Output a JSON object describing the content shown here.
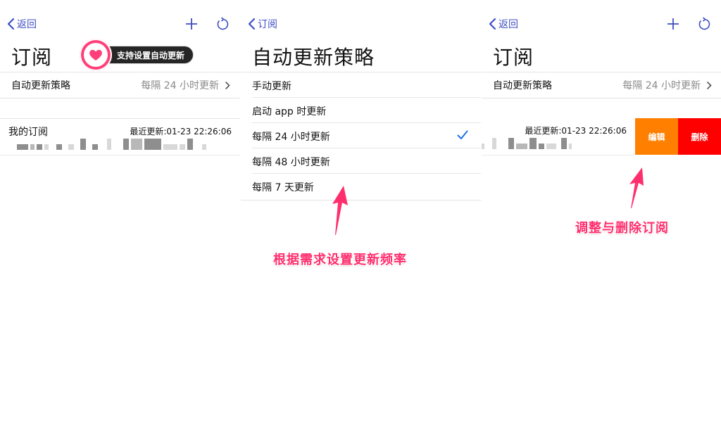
{
  "colors": {
    "accent": "#3d4fc4",
    "check": "#1a73e8",
    "edit": "#ff8000",
    "delete": "#ff0000",
    "annotation": "#ff2e6d",
    "callout_bg": "#262626"
  },
  "panel1": {
    "back_label": "返回",
    "plus_icon": "plus-icon",
    "refresh_icon": "refresh-icon",
    "title": "订阅",
    "callout": "支持设置自动更新",
    "policy_row": {
      "label": "自动更新策略",
      "value": "每隔 24 小时更新"
    },
    "subscription": {
      "name": "我的订阅",
      "last_update": "最近更新:01-23 22:26:06"
    }
  },
  "panel2": {
    "back_label": "订阅",
    "title": "自动更新策略",
    "options": [
      {
        "label": "手动更新",
        "selected": false
      },
      {
        "label": "启动 app 时更新",
        "selected": false
      },
      {
        "label": "每隔 24 小时更新",
        "selected": true
      },
      {
        "label": "每隔 48 小时更新",
        "selected": false
      },
      {
        "label": "每隔 7 天更新",
        "selected": false
      }
    ],
    "annotation": "根据需求设置更新频率"
  },
  "panel3": {
    "back_label": "返回",
    "title": "订阅",
    "policy_row": {
      "label": "自动更新策略",
      "value": "每隔 24 小时更新"
    },
    "subscription": {
      "last_update": "最近更新:01-23 22:26:06"
    },
    "actions": {
      "edit": "编辑",
      "delete": "删除"
    },
    "annotation": "调整与删除订阅"
  }
}
